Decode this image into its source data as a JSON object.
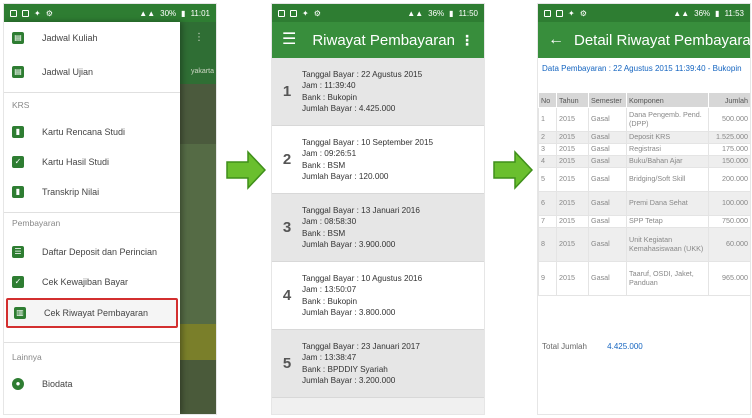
{
  "status_bar": {
    "phone1": {
      "signal": "30%",
      "time": "11:01"
    },
    "phone2": {
      "signal": "36%",
      "time": "11:50"
    },
    "phone3": {
      "signal": "36%",
      "time": "11:53"
    }
  },
  "drawer": {
    "top_items": [
      {
        "label": "Jadwal Kuliah",
        "icon": "calendar-icon"
      },
      {
        "label": "Jadwal Ujian",
        "icon": "calendar-icon"
      }
    ],
    "section_krs": "KRS",
    "krs_items": [
      {
        "label": "Kartu Rencana Studi",
        "icon": "clipboard-icon"
      },
      {
        "label": "Kartu Hasil Studi",
        "icon": "check-icon"
      },
      {
        "label": "Transkrip Nilai",
        "icon": "document-icon"
      }
    ],
    "section_pembayaran": "Pembayaran",
    "pembayaran_items": [
      {
        "label": "Daftar Deposit dan Perincian",
        "icon": "list-icon"
      },
      {
        "label": "Cek Kewajiban Bayar",
        "icon": "check-icon"
      },
      {
        "label": "Cek Riwayat Pembayaran",
        "icon": "chart-icon"
      }
    ],
    "section_lainnya": "Lainnya",
    "lainnya_items": [
      {
        "label": "Biodata",
        "icon": "person-icon"
      }
    ],
    "bg_partial_text": "yakarta"
  },
  "riwayat": {
    "title": "Riwayat Pembayaran",
    "items": [
      {
        "no": "1",
        "tanggal": "Tanggal Bayar : 22 Agustus 2015",
        "jam": "Jam : 11:39:40",
        "bank": "Bank : Bukopin",
        "jumlah": "Jumlah Bayar : 4.425.000"
      },
      {
        "no": "2",
        "tanggal": "Tanggal Bayar : 10 September 2015",
        "jam": "Jam : 09:26:51",
        "bank": "Bank : BSM",
        "jumlah": "Jumlah Bayar : 120.000"
      },
      {
        "no": "3",
        "tanggal": "Tanggal Bayar : 13 Januari 2016",
        "jam": "Jam : 08:58:30",
        "bank": "Bank : BSM",
        "jumlah": "Jumlah Bayar : 3.900.000"
      },
      {
        "no": "4",
        "tanggal": "Tanggal Bayar : 10 Agustus 2016",
        "jam": "Jam : 13:50:07",
        "bank": "Bank : Bukopin",
        "jumlah": "Jumlah Bayar : 3.800.000"
      },
      {
        "no": "5",
        "tanggal": "Tanggal Bayar : 23 Januari 2017",
        "jam": "Jam : 13:38:47",
        "bank": "Bank : BPDDIY Syariah",
        "jumlah": "Jumlah Bayar : 3.200.000"
      }
    ]
  },
  "detail": {
    "title": "Detail Riwayat Pembayaran",
    "info": "Data Pembayaran : 22 Agustus 2015 11:39:40 - Bukopin",
    "headers": [
      "No",
      "Tahun",
      "Semester",
      "Komponen",
      "Jumlah"
    ],
    "rows": [
      [
        "1",
        "2015",
        "Gasal",
        "Dana Pengemb. Pend. (DPP)",
        "500.000"
      ],
      [
        "2",
        "2015",
        "Gasal",
        "Deposit KRS",
        "1.525.000"
      ],
      [
        "3",
        "2015",
        "Gasal",
        "Registrasi",
        "175.000"
      ],
      [
        "4",
        "2015",
        "Gasal",
        "Buku/Bahan Ajar",
        "150.000"
      ],
      [
        "5",
        "2015",
        "Gasal",
        "Bridging/Soft Skill",
        "200.000"
      ],
      [
        "6",
        "2015",
        "Gasal",
        "Premi Dana Sehat",
        "100.000"
      ],
      [
        "7",
        "2015",
        "Gasal",
        "SPP Tetap",
        "750.000"
      ],
      [
        "8",
        "2015",
        "Gasal",
        "Unit Kegiatan Kemahasiswaan (UKK)",
        "60.000"
      ],
      [
        "9",
        "2015",
        "Gasal",
        "Taaruf, OSDI, Jaket, Panduan",
        "965.000"
      ]
    ],
    "total_label": "Total Jumlah",
    "total_value": "4.425.000"
  },
  "colors": {
    "primary": "#388e3c",
    "primary_dark": "#2e7d32",
    "highlight_border": "#d32f2f",
    "arrow_fill": "#6abf2e",
    "link_blue": "#1565c0"
  }
}
